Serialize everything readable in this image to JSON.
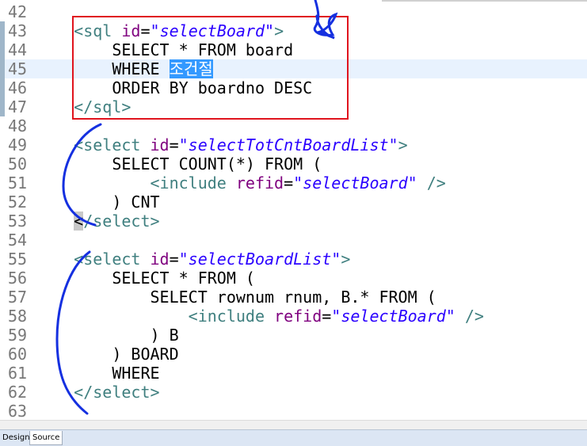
{
  "editor": {
    "lines": [
      {
        "num": "42",
        "segments": []
      },
      {
        "num": "43",
        "segments": [
          {
            "t": "    ",
            "c": "plain"
          },
          {
            "t": "<sql ",
            "c": "tag"
          },
          {
            "t": "id",
            "c": "attr"
          },
          {
            "t": "=",
            "c": "plain"
          },
          {
            "t": "\"selectBoard\"",
            "c": "val"
          },
          {
            "t": ">",
            "c": "tag"
          }
        ]
      },
      {
        "num": "44",
        "segments": [
          {
            "t": "        SELECT * FROM board",
            "c": "plain"
          }
        ]
      },
      {
        "num": "45",
        "current": true,
        "segments": [
          {
            "t": "        WHERE ",
            "c": "plain"
          },
          {
            "t": "조건절",
            "c": "sel"
          }
        ]
      },
      {
        "num": "46",
        "segments": [
          {
            "t": "        ORDER BY boardno DESC",
            "c": "plain"
          }
        ]
      },
      {
        "num": "47",
        "segments": [
          {
            "t": "    ",
            "c": "plain"
          },
          {
            "t": "</sql>",
            "c": "tag"
          }
        ]
      },
      {
        "num": "48",
        "segments": []
      },
      {
        "num": "49",
        "segments": [
          {
            "t": "    ",
            "c": "plain"
          },
          {
            "t": "<select ",
            "c": "tag"
          },
          {
            "t": "id",
            "c": "attr"
          },
          {
            "t": "=",
            "c": "plain"
          },
          {
            "t": "\"selectTotCntBoardList\"",
            "c": "val"
          },
          {
            "t": ">",
            "c": "tag"
          }
        ]
      },
      {
        "num": "50",
        "segments": [
          {
            "t": "        SELECT COUNT(*) FROM (",
            "c": "plain"
          }
        ]
      },
      {
        "num": "51",
        "segments": [
          {
            "t": "            ",
            "c": "plain"
          },
          {
            "t": "<include ",
            "c": "tag"
          },
          {
            "t": "refid",
            "c": "attr"
          },
          {
            "t": "=",
            "c": "plain"
          },
          {
            "t": "\"selectBoard\"",
            "c": "val"
          },
          {
            "t": " />",
            "c": "tag"
          }
        ]
      },
      {
        "num": "52",
        "segments": [
          {
            "t": "        ) CNT",
            "c": "plain"
          }
        ]
      },
      {
        "num": "53",
        "segments": [
          {
            "t": "    ",
            "c": "plain"
          },
          {
            "t": "<",
            "c": "bracket-hl"
          },
          {
            "t": "/select>",
            "c": "tag"
          }
        ]
      },
      {
        "num": "54",
        "segments": []
      },
      {
        "num": "55",
        "segments": [
          {
            "t": "    ",
            "c": "plain"
          },
          {
            "t": "<select ",
            "c": "tag"
          },
          {
            "t": "id",
            "c": "attr"
          },
          {
            "t": "=",
            "c": "plain"
          },
          {
            "t": "\"selectBoardList\"",
            "c": "val"
          },
          {
            "t": ">",
            "c": "tag"
          }
        ]
      },
      {
        "num": "56",
        "segments": [
          {
            "t": "        SELECT * FROM (",
            "c": "plain"
          }
        ]
      },
      {
        "num": "57",
        "segments": [
          {
            "t": "            SELECT rownum rnum, B.* FROM (",
            "c": "plain"
          }
        ]
      },
      {
        "num": "58",
        "segments": [
          {
            "t": "                ",
            "c": "plain"
          },
          {
            "t": "<include ",
            "c": "tag"
          },
          {
            "t": "refid",
            "c": "attr"
          },
          {
            "t": "=",
            "c": "plain"
          },
          {
            "t": "\"selectBoard\"",
            "c": "val"
          },
          {
            "t": " />",
            "c": "tag"
          }
        ]
      },
      {
        "num": "59",
        "segments": [
          {
            "t": "            ) B",
            "c": "plain"
          }
        ]
      },
      {
        "num": "60",
        "segments": [
          {
            "t": "        ) BOARD",
            "c": "plain"
          }
        ]
      },
      {
        "num": "61",
        "segments": [
          {
            "t": "        WHERE",
            "c": "plain"
          }
        ]
      },
      {
        "num": "62",
        "segments": [
          {
            "t": "    ",
            "c": "plain"
          },
          {
            "t": "</select>",
            "c": "tag"
          }
        ]
      },
      {
        "num": "63",
        "segments": []
      }
    ]
  },
  "tabs": {
    "design_label": "Design",
    "source_label": "Source"
  }
}
